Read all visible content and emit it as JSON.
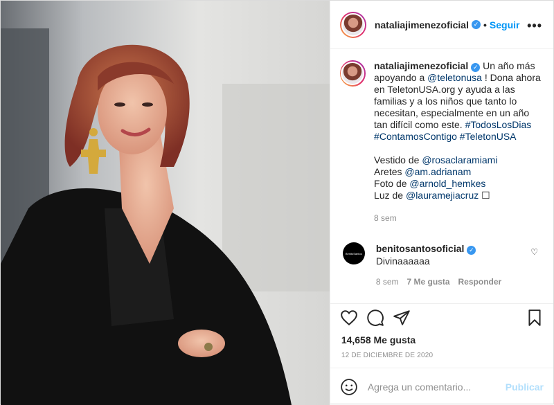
{
  "post": {
    "username": "nataliajimenezoficial",
    "follow_label": "Seguir",
    "separator": "•",
    "more_label": "•••",
    "caption": {
      "text_1": "Un año más apoyando a ",
      "mention_1": "@teletonusa",
      "text_2": " ! Dona ahora en TeletonUSA.org y ayuda a las familias y a los niños que tanto lo necesitan, especialmente en un año tan difícil como este. ",
      "hashtag_1": "#TodosLosDias",
      "hashtag_2": "#ContamosContigo",
      "hashtag_3": "#TeletonUSA",
      "credit_1_label": "Vestido de ",
      "credit_1_mention": "@rosaclaramiami",
      "credit_2_label": "Aretes ",
      "credit_2_mention": "@am.adrianam",
      "credit_3_label": "Foto de ",
      "credit_3_mention": "@arnold_hemkes",
      "credit_4_label": "Luz de ",
      "credit_4_mention": "@laurameјiacruz",
      "trailing_glyph": "☐",
      "age": "8 sem"
    },
    "comment": {
      "username": "benitosantosoficial",
      "avatar_text": "BenitoSantos",
      "text": "Divinaaaaaa",
      "age": "8 sem",
      "likes": "7 Me gusta",
      "reply": "Responder"
    },
    "likes": "14,658 Me gusta",
    "date": "12 DE DICIEMBRE DE 2020",
    "input_placeholder": "Agrega un comentario...",
    "publish_label": "Publicar"
  },
  "icons": [
    "heart-icon",
    "comment-icon",
    "share-icon",
    "bookmark-icon",
    "emoji-icon",
    "verified-icon",
    "more-icon"
  ],
  "colors": {
    "link": "#00376b",
    "follow": "#0095f6",
    "verified": "#3897f0",
    "publish_disabled": "#b2dffc"
  }
}
